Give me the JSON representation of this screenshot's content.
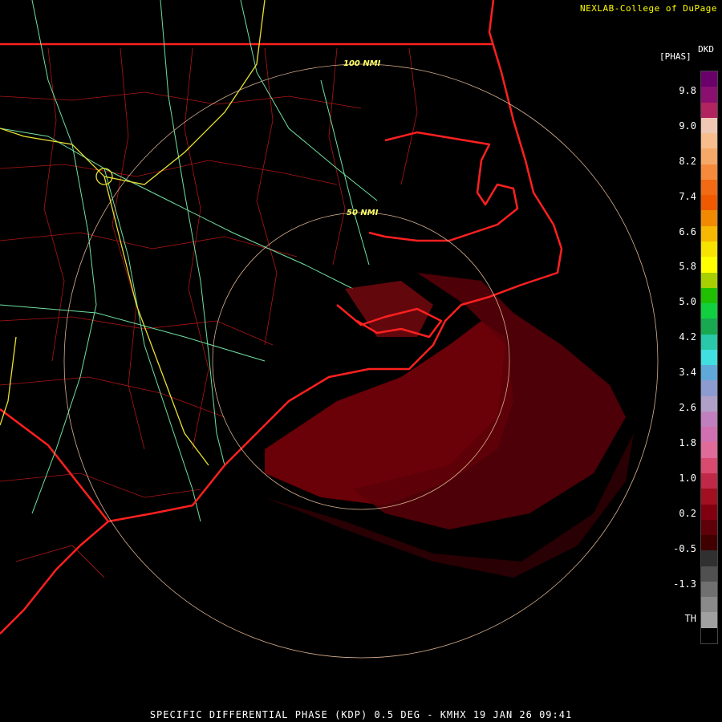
{
  "credit": "NEXLAB-College of DuPage",
  "product_code": "DKD",
  "units": "[PHAS]",
  "footer": "SPECIFIC DIFFERENTIAL PHASE (KDP) 0.5 DEG - KMHX 19 JAN 26 09:41",
  "rings": [
    {
      "label": "50 NMI"
    },
    {
      "label": "100 NMI"
    }
  ],
  "colorbar": {
    "tick_labels": [
      "9.8",
      "9.0",
      "8.2",
      "7.4",
      "6.6",
      "5.8",
      "5.0",
      "4.2",
      "3.4",
      "2.6",
      "1.8",
      "1.0",
      "0.2",
      "-0.5",
      "-1.3",
      "TH"
    ],
    "colors": [
      "#6a006a",
      "#8a0f6e",
      "#b2245f",
      "#f0c8b4",
      "#f8bd8c",
      "#f6a868",
      "#f58a3c",
      "#f26a14",
      "#ef5a00",
      "#f18a00",
      "#f6b800",
      "#f8e200",
      "#ffff00",
      "#a8d000",
      "#20c000",
      "#10d040",
      "#18a850",
      "#28c8a8",
      "#40e0e0",
      "#60a8d8",
      "#8c9cd0",
      "#b0a0c8",
      "#c080c0",
      "#d070b0",
      "#e06a9a",
      "#d84a70",
      "#c02848",
      "#a01020",
      "#800010",
      "#600008",
      "#400000",
      "#303030",
      "#505050",
      "#707070",
      "#8a8a8a",
      "#a0a0a0",
      "#000000"
    ],
    "accent": "#ffff00"
  },
  "map_colors": {
    "coast": "#ff2020",
    "county": "#c41818",
    "highway": "#70e0a0",
    "interstate": "#e8e030",
    "ring": "#d8b090",
    "echo": "#6a0008"
  }
}
